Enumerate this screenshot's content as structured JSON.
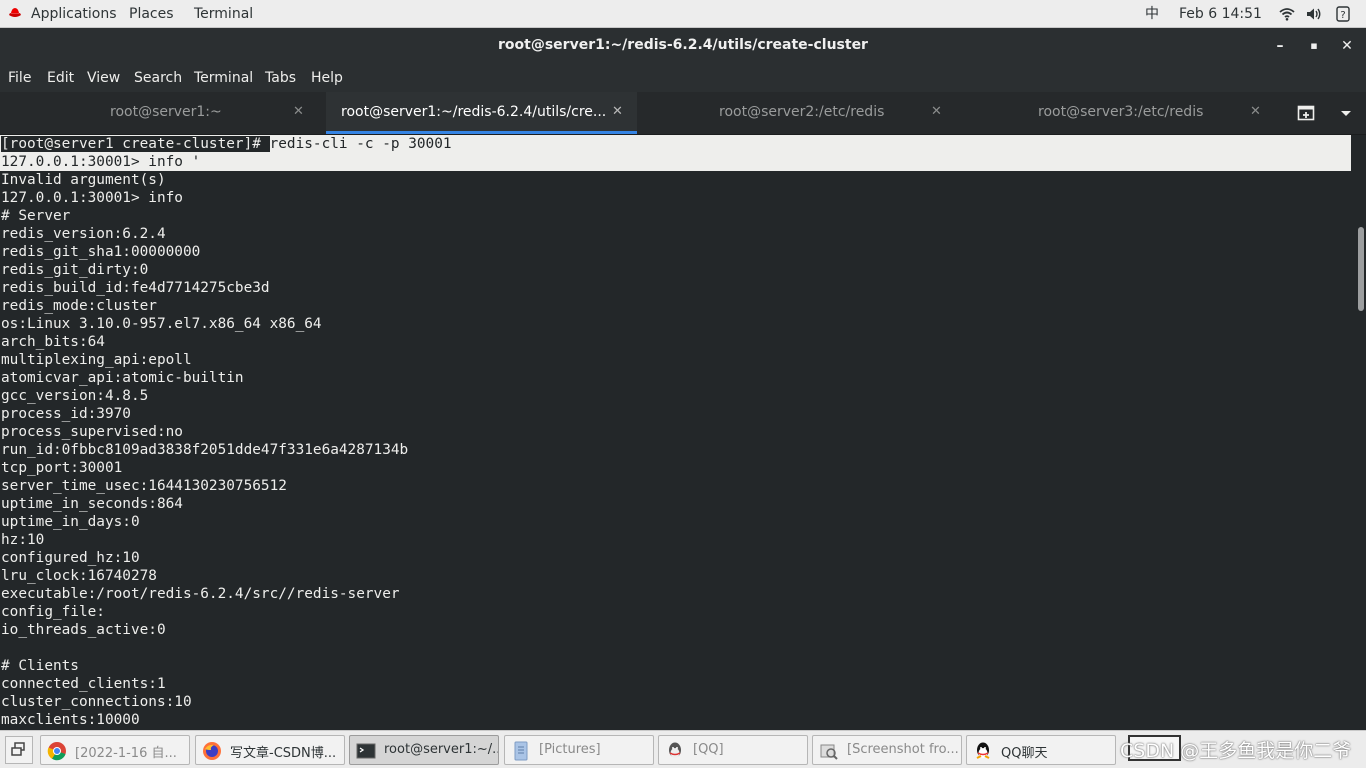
{
  "top_panel": {
    "applications": "Applications",
    "places": "Places",
    "terminal": "Terminal",
    "input_method": "中",
    "datetime": "Feb 6  14:51",
    "icons": [
      "wifi-icon",
      "volume-icon",
      "help-icon"
    ]
  },
  "window": {
    "title": "root@server1:~/redis-6.2.4/utils/create-cluster",
    "minimize": "–",
    "maximize": "▪",
    "close": "✕"
  },
  "menu": [
    "File",
    "Edit",
    "View",
    "Search",
    "Terminal",
    "Tabs",
    "Help"
  ],
  "tabs": [
    {
      "label": "root@server1:~",
      "close": "✕",
      "active": false
    },
    {
      "label": "root@server1:~/redis-6.2.4/utils/cre...",
      "close": "✕",
      "active": true
    },
    {
      "label": "root@server2:/etc/redis",
      "close": "✕",
      "active": false
    },
    {
      "label": "root@server3:/etc/redis",
      "close": "✕",
      "active": false
    }
  ],
  "terminal": {
    "prompt": "[root@server1 create-cluster]# ",
    "command": "redis-cli -c -p 30001",
    "line1": "127.0.0.1:30001> info '",
    "lines": [
      "Invalid argument(s)",
      "127.0.0.1:30001> info",
      "# Server",
      "redis_version:6.2.4",
      "redis_git_sha1:00000000",
      "redis_git_dirty:0",
      "redis_build_id:fe4d7714275cbe3d",
      "redis_mode:cluster",
      "os:Linux 3.10.0-957.el7.x86_64 x86_64",
      "arch_bits:64",
      "multiplexing_api:epoll",
      "atomicvar_api:atomic-builtin",
      "gcc_version:4.8.5",
      "process_id:3970",
      "process_supervised:no",
      "run_id:0fbbc8109ad3838f2051dde47f331e6a4287134b",
      "tcp_port:30001",
      "server_time_usec:1644130230756512",
      "uptime_in_seconds:864",
      "uptime_in_days:0",
      "hz:10",
      "configured_hz:10",
      "lru_clock:16740278",
      "executable:/root/redis-6.2.4/src//redis-server",
      "config_file:",
      "io_threads_active:0",
      "",
      "# Clients",
      "connected_clients:1",
      "cluster_connections:10",
      "maxclients:10000"
    ]
  },
  "taskbar": [
    {
      "label": "[2022-1-16 自...",
      "icon": "chrome-icon"
    },
    {
      "label": "写文章-CSDN博...",
      "icon": "firefox-icon"
    },
    {
      "label": "root@server1:~/...",
      "icon": "terminal-icon"
    },
    {
      "label": "[Pictures]",
      "icon": "files-icon"
    },
    {
      "label": "[QQ]",
      "icon": "qq-icon"
    },
    {
      "label": "[Screenshot fro...",
      "icon": "screenshot-icon"
    },
    {
      "label": "QQ聊天",
      "icon": "qq-icon"
    }
  ],
  "watermark": "CSDN @王多鱼我是你二爷"
}
